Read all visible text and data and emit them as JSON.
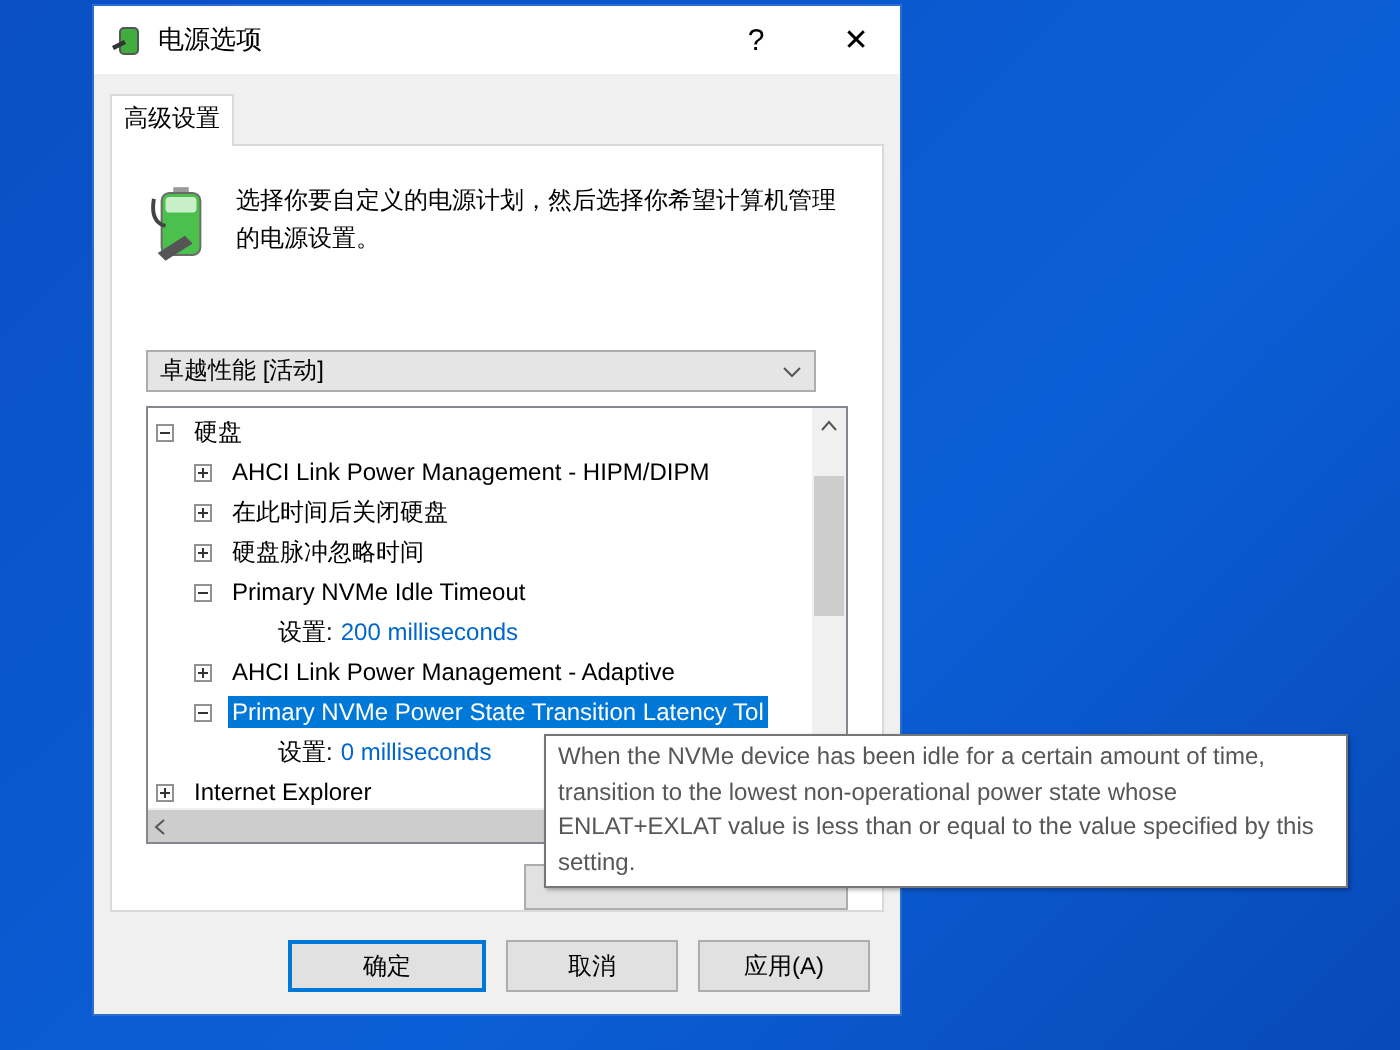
{
  "window": {
    "title": "电源选项",
    "help": "?",
    "close": "✕"
  },
  "tabs": [
    {
      "label": "高级设置",
      "selected": true
    }
  ],
  "intro": "选择你要自定义的电源计划，然后选择你希望计算机管理的电源设置。",
  "plan_select": {
    "value": "卓越性能 [活动]"
  },
  "tree": [
    {
      "label": "硬盘",
      "expanded": true,
      "selected": false,
      "children": [
        {
          "label": "AHCI Link Power Management - HIPM/DIPM",
          "expanded": false,
          "selected": false
        },
        {
          "label": "在此时间后关闭硬盘",
          "expanded": false,
          "selected": false
        },
        {
          "label": "硬盘脉冲忽略时间",
          "expanded": false,
          "selected": false
        },
        {
          "label": "Primary NVMe Idle Timeout",
          "expanded": true,
          "selected": false,
          "setting": {
            "label": "设置:",
            "value": "200 milliseconds"
          }
        },
        {
          "label": "AHCI Link Power Management - Adaptive",
          "expanded": false,
          "selected": false
        },
        {
          "label": "Primary NVMe Power State Transition Latency Tol",
          "expanded": true,
          "selected": true,
          "setting": {
            "label": "设置:",
            "value": "0 milliseconds"
          }
        }
      ]
    },
    {
      "label": "Internet Explorer",
      "expanded": false,
      "selected": false
    }
  ],
  "tooltip": "When the NVMe device has been idle for a certain amount of time, transition to the lowest non-operational power state whose ENLAT+EXLAT value is less than or equal to the value specified by this setting.",
  "buttons": [
    {
      "label": "确定",
      "default": true
    },
    {
      "label": "取消",
      "default": false
    },
    {
      "label": "应用(A)",
      "default": false
    }
  ]
}
